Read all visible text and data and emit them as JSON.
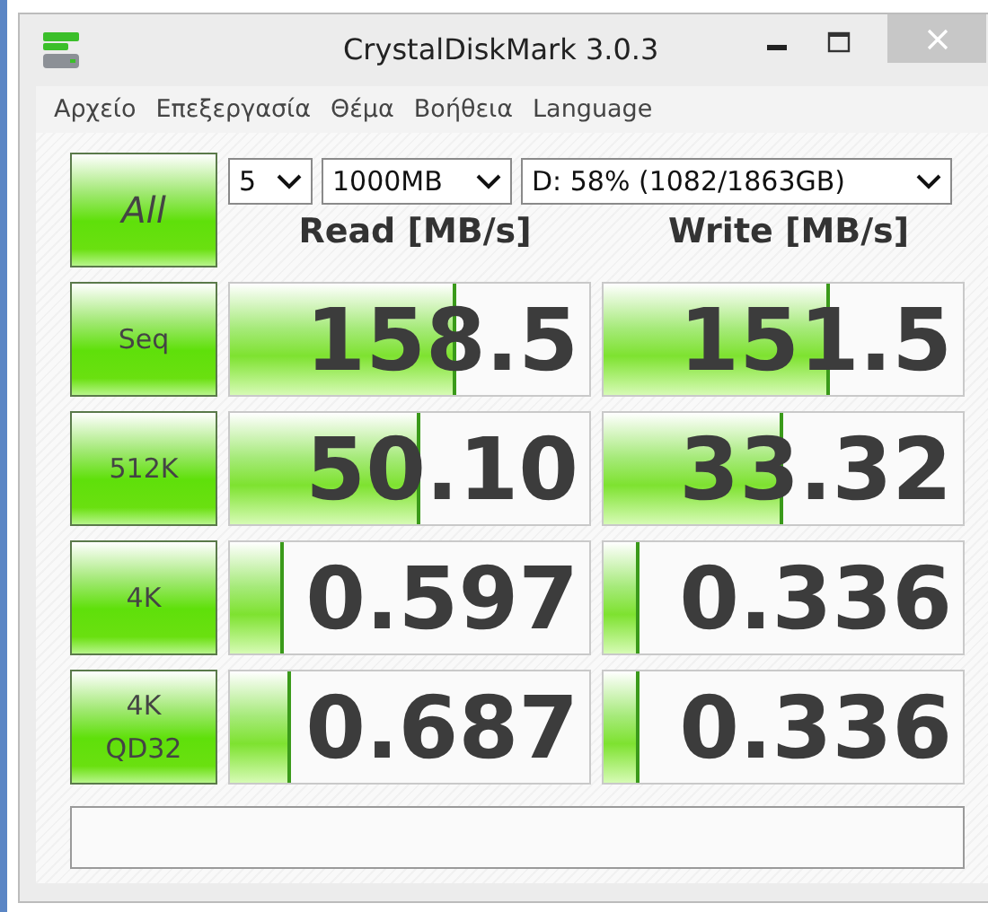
{
  "window": {
    "title": "CrystalDiskMark 3.0.3"
  },
  "menu": [
    "Αρχείο",
    "Επεξεργασία",
    "Θέμα",
    "Βοήθεια",
    "Language"
  ],
  "all_button": "All",
  "settings": {
    "count": "5",
    "size": "1000MB",
    "drive": "D: 58% (1082/1863GB)"
  },
  "columns": [
    "Read [MB/s]",
    "Write [MB/s]"
  ],
  "rows": [
    {
      "label": "Seq",
      "read": {
        "value": "158.5",
        "level": 0.63
      },
      "write": {
        "value": "151.5",
        "level": 0.63
      }
    },
    {
      "label": "512K",
      "read": {
        "value": "50.10",
        "level": 0.53
      },
      "write": {
        "value": "33.32",
        "level": 0.5
      }
    },
    {
      "label": "4K",
      "read": {
        "value": "0.597",
        "level": 0.15
      },
      "write": {
        "value": "0.336",
        "level": 0.1
      }
    },
    {
      "label": "4K\nQD32",
      "read": {
        "value": "0.687",
        "level": 0.17
      },
      "write": {
        "value": "0.336",
        "level": 0.1
      }
    }
  ]
}
